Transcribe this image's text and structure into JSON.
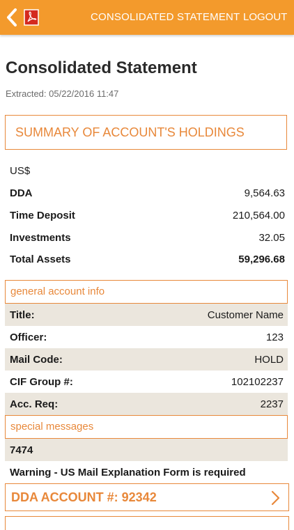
{
  "topbar": {
    "title": "CONSOLIDATED STATEMENT",
    "logout": "LOGOUT",
    "icons": {
      "back": "chevron-left-icon",
      "pdf": "pdf-icon"
    },
    "colors": {
      "bar": "#f39a2c",
      "text": "#ffffff"
    }
  },
  "page": {
    "title": "Consolidated Statement",
    "extracted": "Extracted: 05/22/2016 11:47"
  },
  "summary": {
    "heading": "SUMMARY OF ACCOUNT'S HOLDINGS",
    "currency": "US$",
    "rows": [
      {
        "label": "DDA",
        "value": "9,564.63"
      },
      {
        "label": "Time Deposit",
        "value": "210,564.00"
      },
      {
        "label": "Investments",
        "value": "32.05"
      },
      {
        "label": "Total Assets",
        "value": "59,296.68"
      }
    ]
  },
  "general_info": {
    "heading": "general account info",
    "rows": [
      {
        "label": "Title:",
        "value": "Customer Name"
      },
      {
        "label": "Officer:",
        "value": "123"
      },
      {
        "label": "Mail Code:",
        "value": "HOLD"
      },
      {
        "label": "CIF Group #:",
        "value": "102102237"
      },
      {
        "label": "Acc. Req:",
        "value": "2237"
      }
    ]
  },
  "special_messages": {
    "heading": "special messages",
    "code": "7474",
    "warning": "Warning - US Mail Explanation Form is required"
  },
  "dda_account": {
    "label": "DDA ACCOUNT #: 92342",
    "icon": "chevron-right-icon"
  },
  "colors": {
    "accent": "#e8883a",
    "row_shade": "#ebe6dd"
  }
}
